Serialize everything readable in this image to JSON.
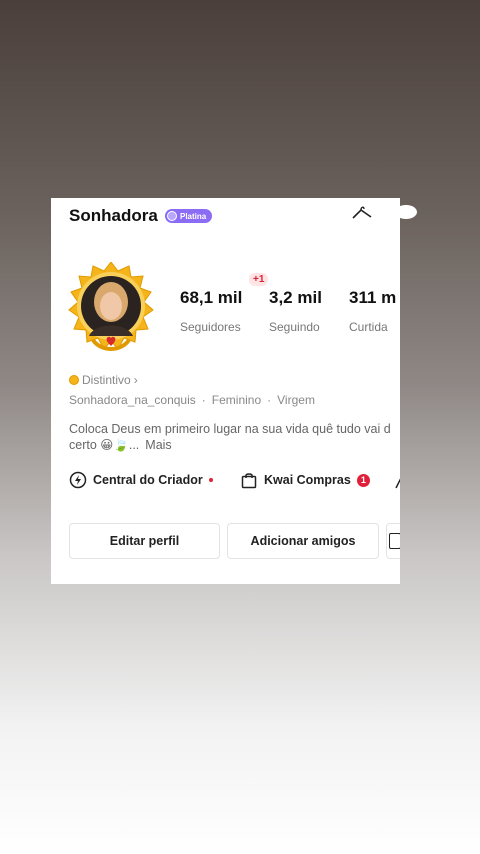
{
  "profile": {
    "name": "Sonhadora",
    "level_badge": "Platina",
    "username": "Sonhadora_na_conquis",
    "gender": "Feminino",
    "sign": "Virgem",
    "distintivo": "Distintivo",
    "bio_line1": "Coloca Deus em primeiro lugar na sua vida quê tudo vai d",
    "bio_line2": "certo 😀🍃...",
    "bio_more": "Mais"
  },
  "stats": {
    "followers_value": "68,1 mil",
    "followers_label": "Seguidores",
    "following_value": "3,2 mil",
    "following_label": "Seguindo",
    "following_new": "+1",
    "likes_value": "311 m",
    "likes_label": "Curtida"
  },
  "quick_actions": {
    "creator_center": "Central do Criador",
    "kwai_shop": "Kwai Compras",
    "kwai_shop_count": "1"
  },
  "buttons": {
    "edit_profile": "Editar perfil",
    "add_friends": "Adicionar amigos"
  },
  "colors": {
    "badge_purple": "#8b6cf5",
    "notification_red": "#e0203a",
    "frame_gold": "#f4b41a"
  }
}
